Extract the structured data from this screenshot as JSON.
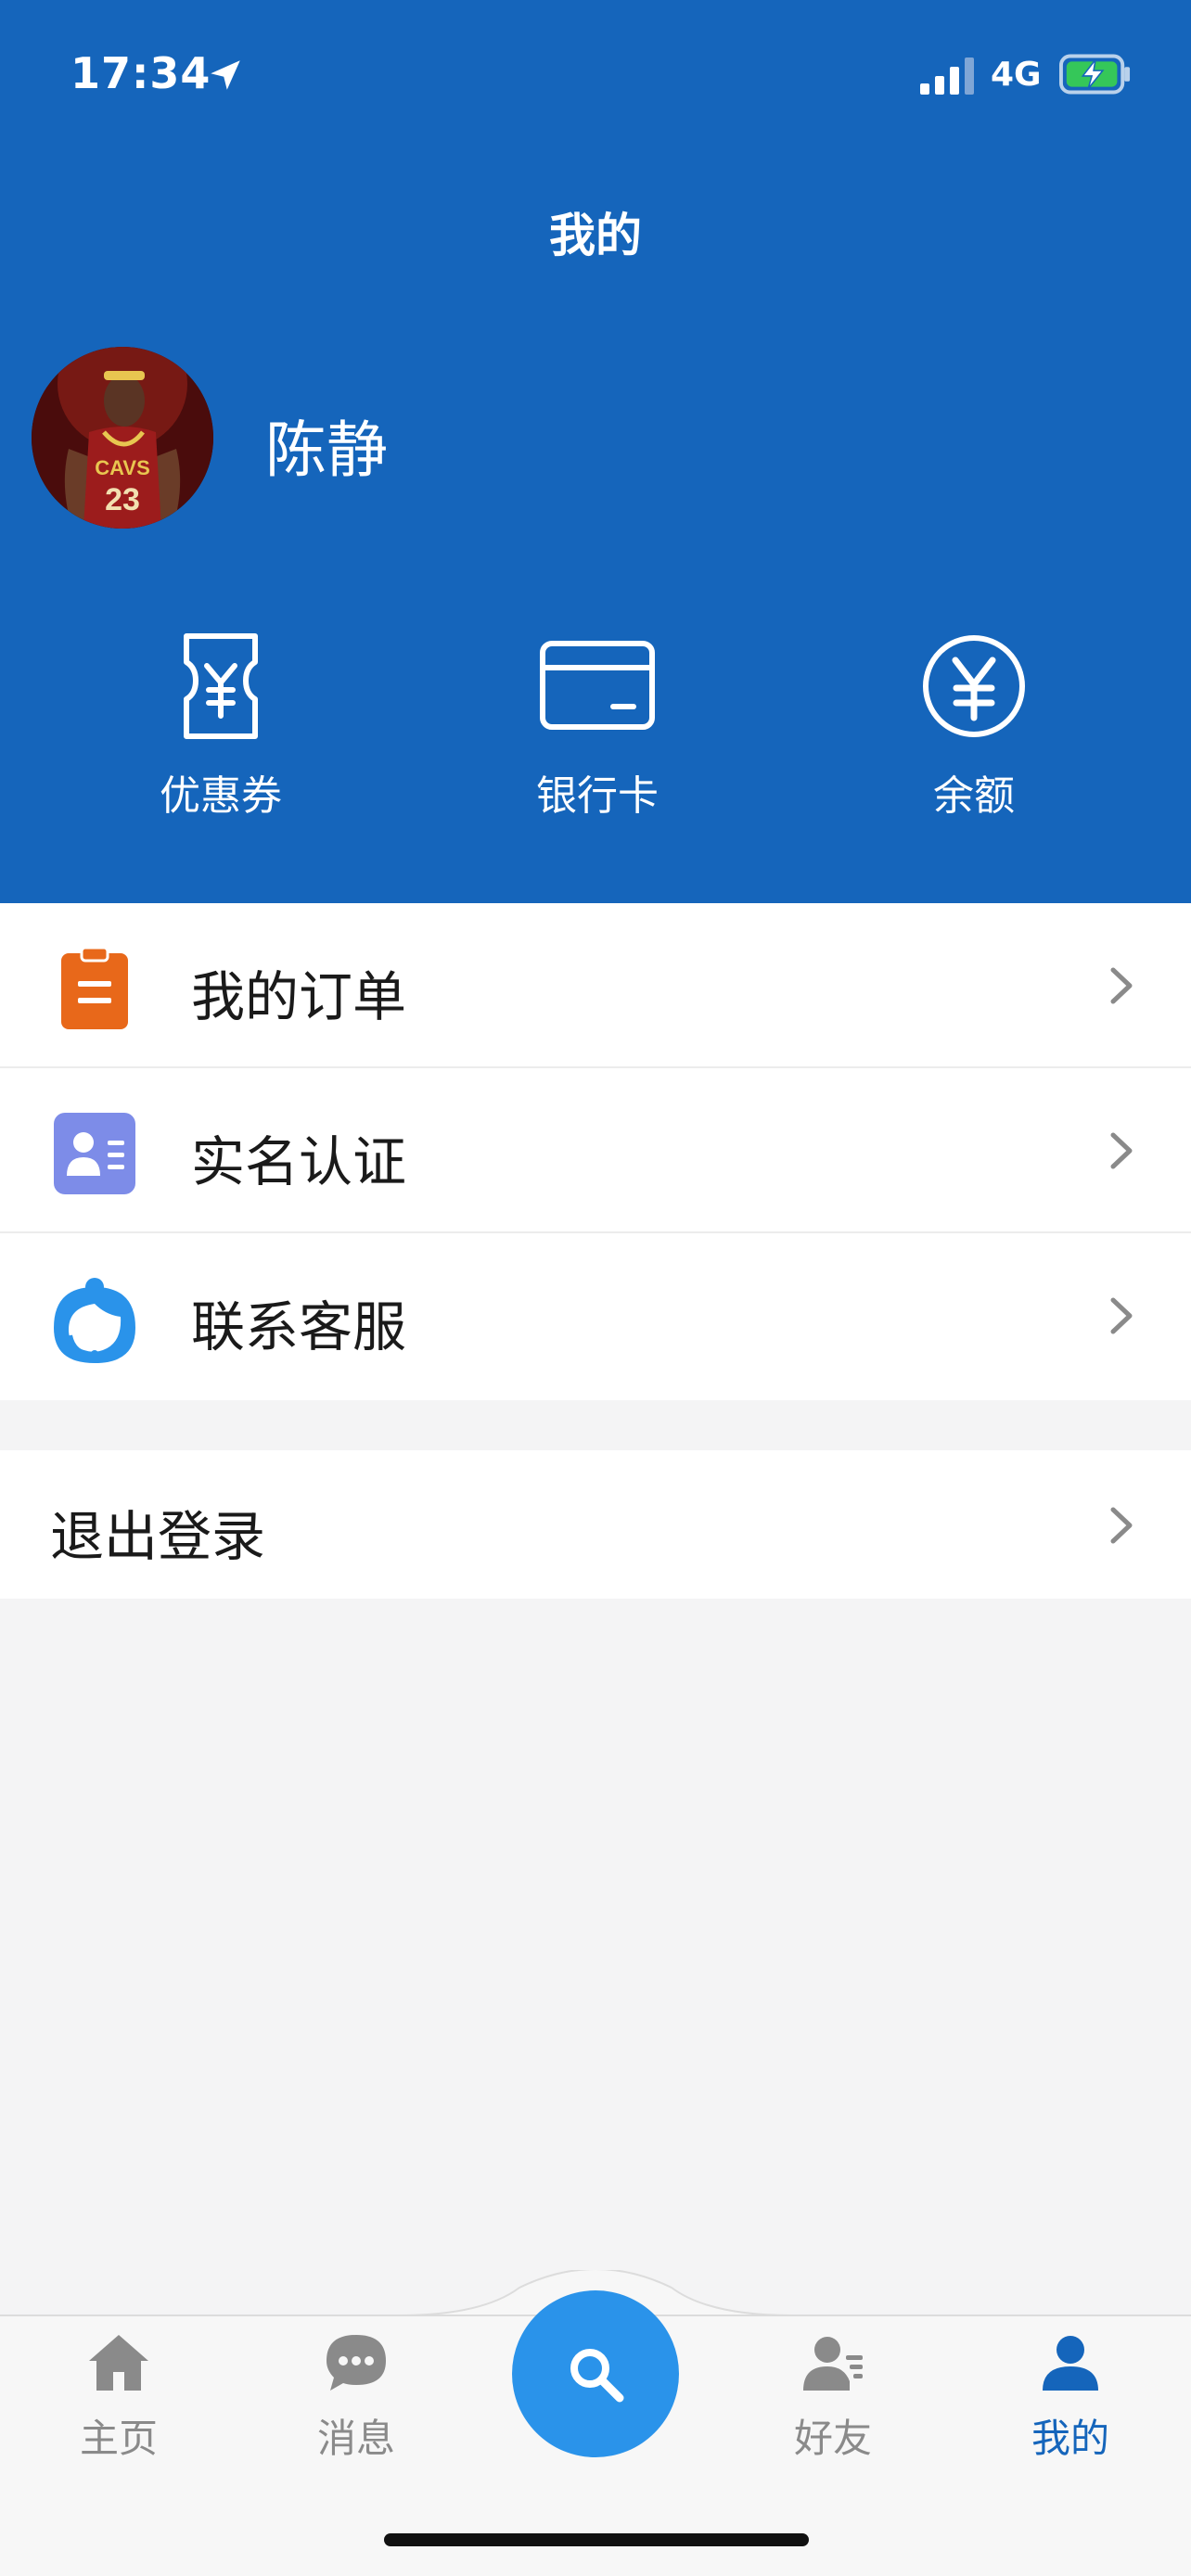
{
  "status_bar": {
    "time": "17:34",
    "network": "4G",
    "icons": [
      "location-arrow-icon",
      "signal-bars-icon",
      "battery-charging-icon"
    ]
  },
  "header": {
    "title": "我的",
    "user_name": "陈静",
    "avatar_icon": "user-avatar-photo",
    "background_color": "#1565bb"
  },
  "quick_actions": [
    {
      "label": "优惠券",
      "icon": "coupon-ticket-icon"
    },
    {
      "label": "银行卡",
      "icon": "bank-card-icon"
    },
    {
      "label": "余额",
      "icon": "yuan-circle-icon"
    }
  ],
  "menu": [
    {
      "label": "我的订单",
      "icon": "clipboard-order-icon",
      "icon_color": "#e8681a"
    },
    {
      "label": "实名认证",
      "icon": "id-card-icon",
      "icon_color": "#7d8ce8"
    },
    {
      "label": "联系客服",
      "icon": "customer-service-icon",
      "icon_color": "#2a93ea"
    }
  ],
  "logout": {
    "label": "退出登录"
  },
  "tabbar": {
    "items": [
      {
        "label": "主页",
        "icon": "home-icon"
      },
      {
        "label": "消息",
        "icon": "chat-bubble-icon"
      },
      {
        "label": "好友",
        "icon": "friends-list-icon"
      },
      {
        "label": "我的",
        "icon": "person-icon",
        "active": true
      }
    ],
    "center_button_icon": "search-icon",
    "active_color": "#1565bb",
    "inactive_color": "#8a8a8a",
    "center_color": "#2a93ea"
  }
}
